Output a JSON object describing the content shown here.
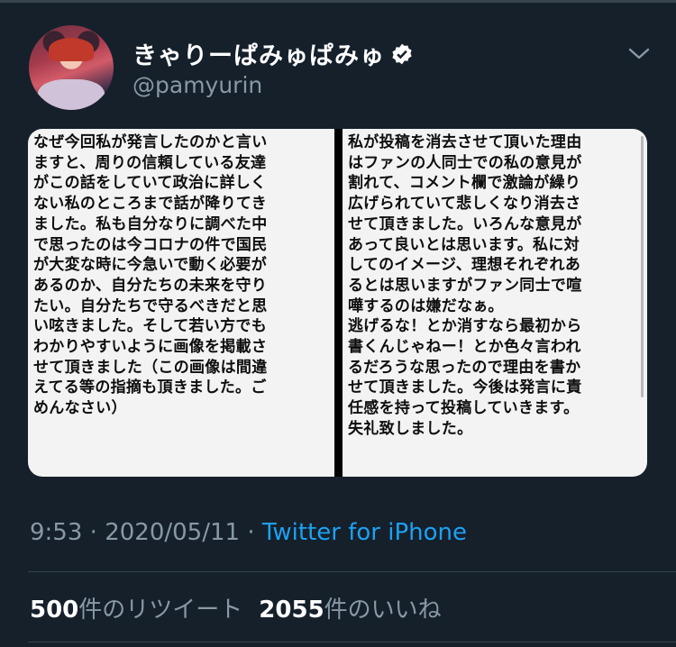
{
  "author": {
    "display_name": "きゃりーぱみゅぱみゅ",
    "handle": "@pamyurin"
  },
  "media": {
    "left_text": "なぜ今回私が発言したのかと言い\nますと、周りの信頼している友達\nがこの話をしていて政治に詳しく\nない私のところまで話が降りてき\nました。私も自分なりに調べた中\nで思ったのは今コロナの件で国民\nが大変な時に今急いで動く必要が\nあるのか、自分たちの未来を守り\nたい。自分たちで守るべきだと思\nい呟きました。そして若い方でも\nわかりやすいように画像を掲載さ\nせて頂きました（この画像は間違\nえてる等の指摘も頂きました。ご\nめんなさい）",
    "right_text": "私が投稿を消去させて頂いた理由\nはファンの人同士での私の意見が\n割れて、コメント欄で激論が繰り\n広げられていて悲しくなり消去さ\nせて頂きました。いろんな意見が\nあって良いとは思います。私に対\nしてのイメージ、理想それぞれあ\nるとは思いますがファン同士で喧\n嘩するのは嫌だなぁ。\n逃げるな！とか消すなら最初から\n書くんじゃねー！とか色々言われ\nるだろうな思ったので理由を書か\nせて頂きました。今後は発言に責\n任感を持って投稿していきます。\n失礼致しました。"
  },
  "meta": {
    "time": "9:53",
    "date": "2020/05/11",
    "separator": "·",
    "source": "Twitter for iPhone"
  },
  "stats": {
    "retweets_count": "500",
    "retweets_label": "件のリツイート",
    "likes_count": "2055",
    "likes_label": "件のいいね"
  },
  "colors": {
    "background": "#15202b",
    "accent": "#1da1f2",
    "secondary_text": "#8899a6"
  },
  "icons": [
    "verified-icon",
    "chevron-down-icon"
  ]
}
